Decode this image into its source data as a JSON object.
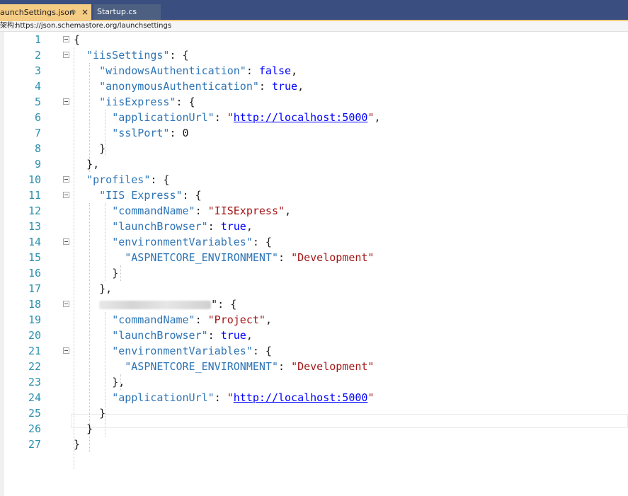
{
  "tabs": [
    {
      "label": "aunchSettings.json",
      "pin": "⊕",
      "close": "×",
      "active": true
    },
    {
      "label": "Startup.cs",
      "active": false
    }
  ],
  "schema": {
    "prefix": "架构:",
    "url": "https://json.schemastore.org/launchsettings"
  },
  "line_numbers": [
    "1",
    "2",
    "3",
    "4",
    "5",
    "6",
    "7",
    "8",
    "9",
    "10",
    "11",
    "12",
    "13",
    "14",
    "15",
    "16",
    "17",
    "18",
    "19",
    "20",
    "21",
    "22",
    "23",
    "24",
    "25",
    "26",
    "27"
  ],
  "code": {
    "l1": "{",
    "l2_key": "\"iisSettings\"",
    "l2_rest": ": {",
    "l3_key": "\"windowsAuthentication\"",
    "l3_sep": ": ",
    "l3_val": "false",
    "l3_end": ",",
    "l4_key": "\"anonymousAuthentication\"",
    "l4_sep": ": ",
    "l4_val": "true",
    "l4_end": ",",
    "l5_key": "\"iisExpress\"",
    "l5_rest": ": {",
    "l6_key": "\"applicationUrl\"",
    "l6_sep": ": ",
    "l6_q1": "\"",
    "l6_url": "http://localhost:5000",
    "l6_q2": "\"",
    "l6_end": ",",
    "l7_key": "\"sslPort\"",
    "l7_sep": ": ",
    "l7_val": "0",
    "l8": "}",
    "l9": "},",
    "l10_key": "\"profiles\"",
    "l10_rest": ": {",
    "l11_key": "\"IIS Express\"",
    "l11_rest": ": {",
    "l12_key": "\"commandName\"",
    "l12_sep": ": ",
    "l12_val": "\"IISExpress\"",
    "l12_end": ",",
    "l13_key": "\"launchBrowser\"",
    "l13_sep": ": ",
    "l13_val": "true",
    "l13_end": ",",
    "l14_key": "\"environmentVariables\"",
    "l14_rest": ": {",
    "l15_key": "\"ASPNETCORE_ENVIRONMENT\"",
    "l15_sep": ": ",
    "l15_val": "\"Development\"",
    "l16": "}",
    "l17": "},",
    "l18_rest": "\": {",
    "l19_key": "\"commandName\"",
    "l19_sep": ": ",
    "l19_val": "\"Project\"",
    "l19_end": ",",
    "l20_key": "\"launchBrowser\"",
    "l20_sep": ": ",
    "l20_val": "true",
    "l20_end": ",",
    "l21_key": "\"environmentVariables\"",
    "l21_rest": ": {",
    "l22_key": "\"ASPNETCORE_ENVIRONMENT\"",
    "l22_sep": ": ",
    "l22_val": "\"Development\"",
    "l23": "},",
    "l24_key": "\"applicationUrl\"",
    "l24_sep": ": ",
    "l24_q1": "\"",
    "l24_url": "http://localhost:5000",
    "l24_q2": "\"",
    "l25": "}",
    "l26": "}",
    "l27": "}"
  },
  "colors": {
    "tab_active": "#f5cc84",
    "tab_bar": "#3a4e80",
    "key": "#2e75b6",
    "string": "#a31515",
    "keyword": "#0000ff",
    "line_number": "#2b91af"
  }
}
